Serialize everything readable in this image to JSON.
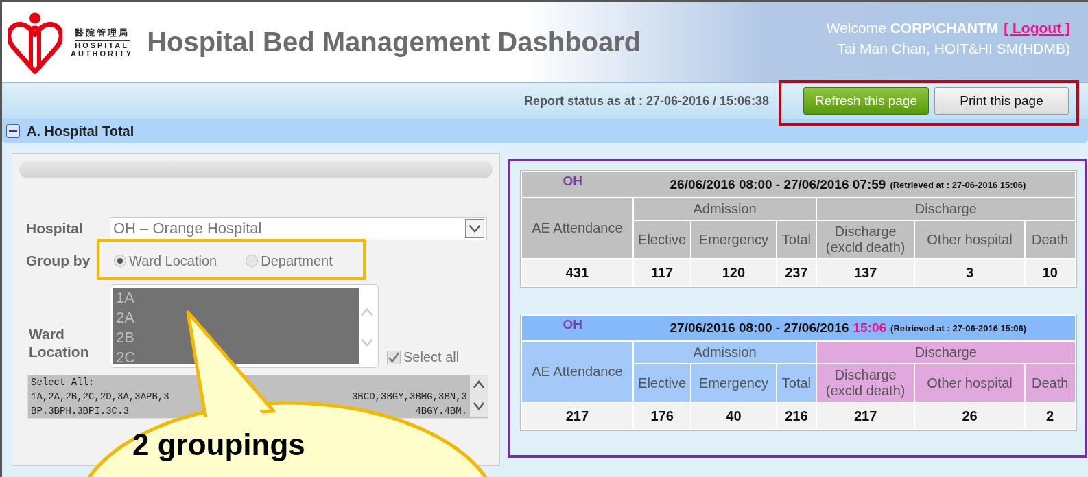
{
  "header": {
    "logo_lines": [
      "醫院管理局",
      "HOSPITAL",
      "AUTHORITY"
    ],
    "title": "Hospital Bed Management Dashboard",
    "welcome": {
      "prefix": "Welcome",
      "user": "CORP\\CHANTM",
      "logout": "[ Logout ]"
    },
    "user_info": "Tai Man Chan, HOIT&HI SM(HDMB)"
  },
  "status_bar": {
    "report_status": "Report status as at : 27-06-2016 / 15:06:38",
    "buttons": [
      {
        "label": "Refresh this page",
        "kind": "primary"
      },
      {
        "label": "Print this page",
        "kind": "plain"
      }
    ]
  },
  "section": {
    "title": "A. Hospital Total",
    "expanded": true
  },
  "filters": {
    "hospital": {
      "label": "Hospital",
      "value": "OH – Orange Hospital"
    },
    "group_by": {
      "label": "Group by",
      "options": [
        {
          "label": "Ward Location",
          "selected": true
        },
        {
          "label": "Department",
          "selected": false
        }
      ]
    },
    "ward_location": {
      "label": "Ward Location",
      "items": [
        {
          "label": "1A",
          "selected": true
        },
        {
          "label": "2A",
          "selected": true
        },
        {
          "label": "2B",
          "selected": true
        },
        {
          "label": "2C",
          "selected": true
        }
      ],
      "select_all": {
        "label": "Select all",
        "checked": true
      }
    },
    "selection_text": [
      {
        "left": "Select All:"
      },
      {
        "left": "1A,2A,2B,2C,2D,3A,3APB,3",
        "right": "3BCD,3BGY,3BMG,3BN,3"
      },
      {
        "left": "BP.3BPH.3BPI.3C.3",
        "right": "4BGY.4BM."
      }
    ]
  },
  "tables": [
    {
      "kind": "previous",
      "hospital": "OH",
      "period": "26/06/2016 08:00 - 27/06/2016 07:59",
      "retrieved": "(Retrieved at : 27-06-2016 15:06)",
      "first_column": "AE Attendance",
      "groups": [
        {
          "label": "Admission",
          "columns": [
            "Elective",
            "Emergency",
            "Total"
          ]
        },
        {
          "label": "Discharge",
          "columns": [
            "Discharge (excld death)",
            "Other hospital",
            "Death"
          ]
        }
      ],
      "values": [
        "431",
        "117",
        "120",
        "237",
        "137",
        "3",
        "10"
      ]
    },
    {
      "kind": "current",
      "hospital": "OH",
      "period": "27/06/2016 08:00 - 27/06/2016",
      "period_highlight": "15:06",
      "retrieved": "(Retrieved at : 27-06-2016 15:06)",
      "first_column": "AE Attendance",
      "groups": [
        {
          "label": "Admission",
          "columns": [
            "Elective",
            "Emergency",
            "Total"
          ]
        },
        {
          "label": "Discharge",
          "columns": [
            "Discharge (excld death)",
            "Other hospital",
            "Death"
          ]
        }
      ],
      "values": [
        "217",
        "176",
        "40",
        "216",
        "217",
        "26",
        "2"
      ]
    }
  ],
  "callout": {
    "text": "2 groupings"
  }
}
